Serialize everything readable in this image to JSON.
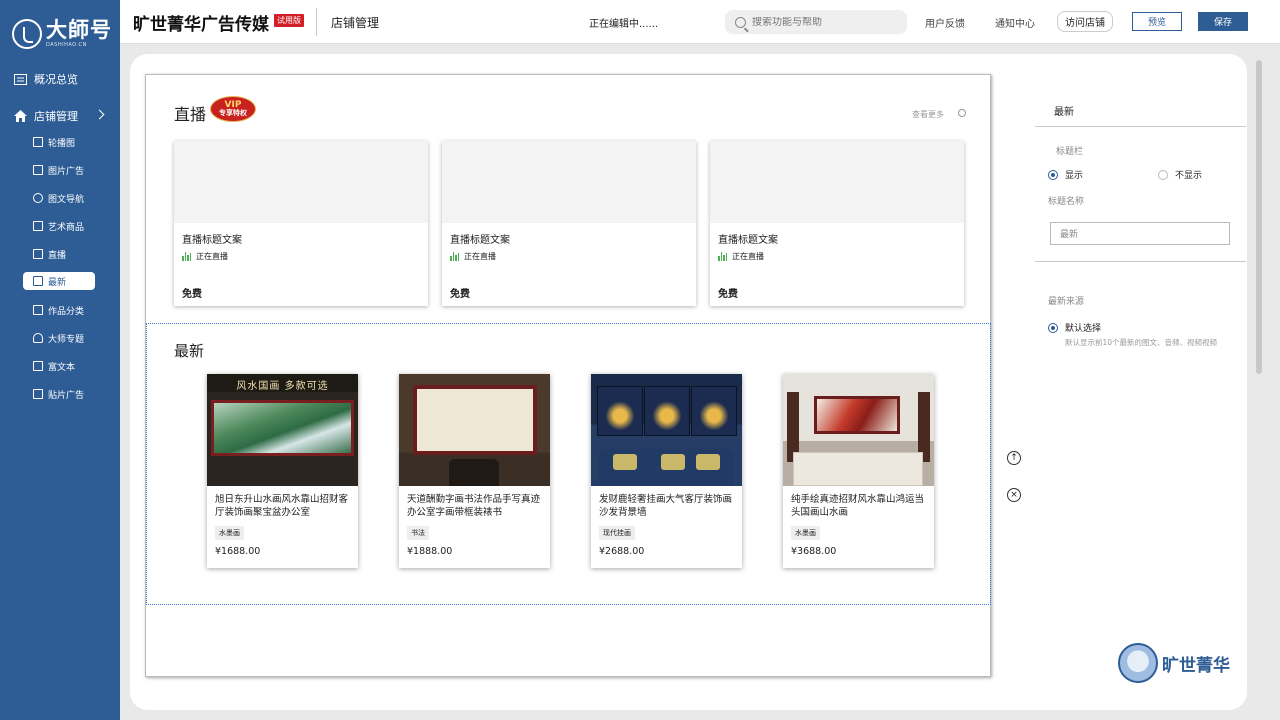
{
  "app": {
    "logo_text": "大師号",
    "logo_subtext": "DASHIHAO.CN",
    "brand": "旷世菁华广告传媒",
    "trial_badge": "试用版",
    "section": "店铺管理",
    "editing_status": "正在编辑中......"
  },
  "header": {
    "search_placeholder": "搜索功能与帮助",
    "feedback": "用户反馈",
    "notifications": "通知中心",
    "visit_store": "访问店铺",
    "preview": "预览",
    "save": "保存"
  },
  "sidebar": {
    "overview": "概况总览",
    "store_manage": "店铺管理",
    "items": [
      {
        "label": "轮播图",
        "icon": "carousel-icon"
      },
      {
        "label": "图片广告",
        "icon": "image-icon"
      },
      {
        "label": "图文导航",
        "icon": "navigation-icon"
      },
      {
        "label": "艺术商品",
        "icon": "art-goods-icon"
      },
      {
        "label": "直播",
        "icon": "live-icon"
      },
      {
        "label": "最新",
        "icon": "latest-icon"
      },
      {
        "label": "作品分类",
        "icon": "category-icon"
      },
      {
        "label": "大师专题",
        "icon": "master-icon"
      },
      {
        "label": "富文本",
        "icon": "richtext-icon"
      },
      {
        "label": "贴片广告",
        "icon": "patch-ad-icon"
      }
    ],
    "active": "最新"
  },
  "live": {
    "title": "直播",
    "vip_top": "VIP",
    "vip_bottom": "专享特权",
    "see_more": "查看更多",
    "cards": [
      {
        "title": "直播标题文案",
        "status": "正在直播",
        "price": "免费"
      },
      {
        "title": "直播标题文案",
        "status": "正在直播",
        "price": "免费"
      },
      {
        "title": "直播标题文案",
        "status": "正在直播",
        "price": "免费"
      }
    ]
  },
  "latest": {
    "title": "最新",
    "banner_text": "风水国画   多款可选",
    "products": [
      {
        "name": "旭日东升山水画风水靠山招财客厅装饰画聚宝盆办公室",
        "tag": "水墨画",
        "price": "¥1688.00"
      },
      {
        "name": "天道酬勤字画书法作品手写真迹办公室字画带框装裱书",
        "tag": "书法",
        "price": "¥1888.00"
      },
      {
        "name": "发财鹿轻奢挂画大气客厅装饰画沙发背景墙",
        "tag": "现代挂画",
        "price": "¥2688.00"
      },
      {
        "name": "纯手绘真迹招财风水靠山鸿运当头国画山水画",
        "tag": "水墨画",
        "price": "¥3688.00"
      }
    ]
  },
  "config": {
    "title": "最新",
    "title_bar_label": "标题栏",
    "show": "显示",
    "hide": "不显示",
    "title_name_label": "标题名称",
    "title_name_value": "最新",
    "source_label": "最新来源",
    "default_option": "默认选择",
    "default_hint": "默认显示前10个最新的图文、音频、视频视频"
  },
  "watermark": {
    "text": "旷世菁华"
  },
  "colors": {
    "brand": "#2e5d96",
    "trial_red": "#d21f27",
    "live_green": "#4caf50"
  }
}
